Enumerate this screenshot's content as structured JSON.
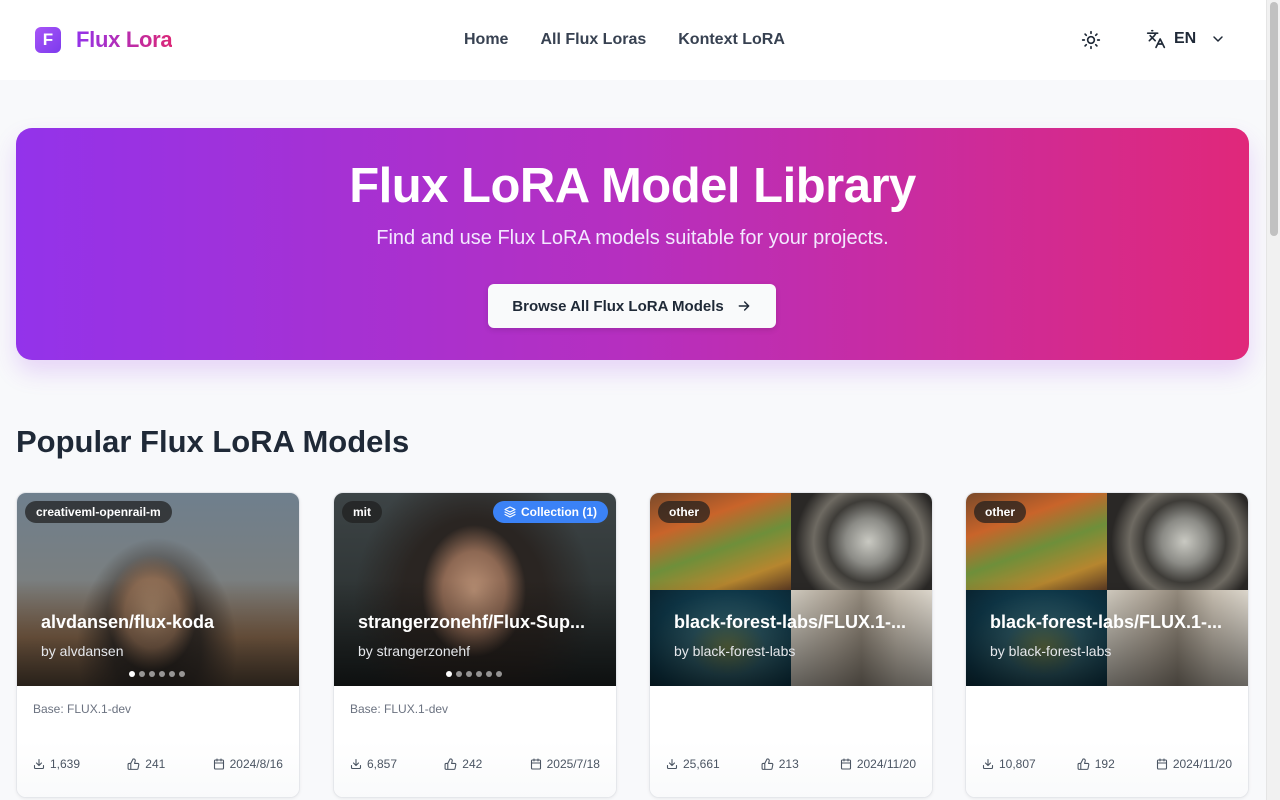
{
  "brand": {
    "logo_letter": "F",
    "name": "Flux Lora"
  },
  "nav": [
    {
      "label": "Home"
    },
    {
      "label": "All Flux Loras"
    },
    {
      "label": "Kontext LoRA"
    }
  ],
  "header": {
    "theme_icon": "sun-icon",
    "language": "EN"
  },
  "hero": {
    "title": "Flux LoRA Model Library",
    "subtitle": "Find and use Flux LoRA models suitable for your projects.",
    "button_label": "Browse All Flux LoRA Models"
  },
  "section": {
    "title": "Popular Flux LoRA Models"
  },
  "cards": [
    {
      "license": "creativeml-openrail-m",
      "title": "alvdansen/flux-koda",
      "author": "by alvdansen",
      "base": "Base: FLUX.1-dev",
      "downloads": "1,639",
      "likes": "241",
      "date": "2024/8/16"
    },
    {
      "license": "mit",
      "collection": "Collection (1)",
      "title": "strangerzonehf/Flux-Sup...",
      "author": "by strangerzonehf",
      "base": "Base: FLUX.1-dev",
      "downloads": "6,857",
      "likes": "242",
      "date": "2025/7/18"
    },
    {
      "license": "other",
      "title": "black-forest-labs/FLUX.1-...",
      "author": "by black-forest-labs",
      "base": "",
      "downloads": "25,661",
      "likes": "213",
      "date": "2024/11/20"
    },
    {
      "license": "other",
      "title": "black-forest-labs/FLUX.1-...",
      "author": "by black-forest-labs",
      "base": "",
      "downloads": "10,807",
      "likes": "192",
      "date": "2024/11/20"
    }
  ],
  "colors": {
    "brand_gradient_start": "#9333ea",
    "brand_gradient_end": "#db2777",
    "collection_badge": "#3b82f6"
  }
}
